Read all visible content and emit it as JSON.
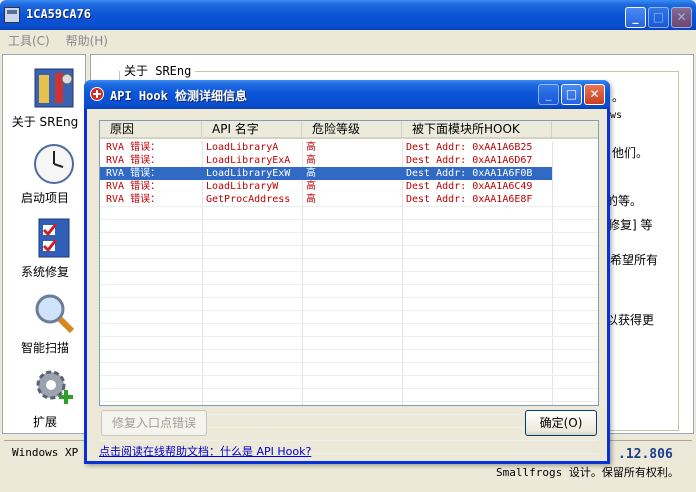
{
  "main_window": {
    "title": "1CA59CA76",
    "menu": [
      "工具(C)",
      "帮助(H)"
    ],
    "sidebar": [
      {
        "label": "关于 SREng",
        "icon": "tools-icon"
      },
      {
        "label": "启动项目",
        "icon": "clock-icon"
      },
      {
        "label": "系统修复",
        "icon": "checklist-icon"
      },
      {
        "label": "智能扫描",
        "icon": "magnifier-icon"
      },
      {
        "label": "扩展",
        "icon": "gear-plus-icon"
      }
    ],
    "about_legend": "关于 SREng",
    "background_snippets": [
      "。",
      "ws",
      "他们。",
      "的等。",
      "修复] 等",
      "希望所有",
      "以获得更"
    ],
    "status_left": "Windows XP P",
    "version": ".12.806",
    "copyright": "Smallfrogs 设计。保留所有权利。"
  },
  "dialog": {
    "title": "API Hook 检测详细信息",
    "columns": [
      "原因",
      "API 名字",
      "危险等级",
      "被下面模块所HOOK"
    ],
    "rows": [
      {
        "reason": "RVA  错误：",
        "api": "LoadLibraryA",
        "level": "高",
        "module": "Dest Addr: 0xAA1A6B25"
      },
      {
        "reason": "RVA  错误：",
        "api": "LoadLibraryExA",
        "level": "高",
        "module": "Dest Addr: 0xAA1A6D67"
      },
      {
        "reason": "RVA  错误：",
        "api": "LoadLibraryExW",
        "level": "高",
        "module": "Dest Addr: 0xAA1A6F0B"
      },
      {
        "reason": "RVA  错误：",
        "api": "LoadLibraryW",
        "level": "高",
        "module": "Dest Addr: 0xAA1A6C49"
      },
      {
        "reason": "RVA  错误：",
        "api": "GetProcAddress",
        "level": "高",
        "module": "Dest Addr: 0xAA1A6E8F"
      }
    ],
    "selected_row": 2,
    "repair_button": "修复入口点错误",
    "ok_button": "确定(O)",
    "help_link": "点击阅读在线帮助文档：什么是 API Hook?"
  },
  "colors": {
    "title_blue": "#0a54d6",
    "error_red": "#c00000",
    "selection": "#316ac5"
  }
}
